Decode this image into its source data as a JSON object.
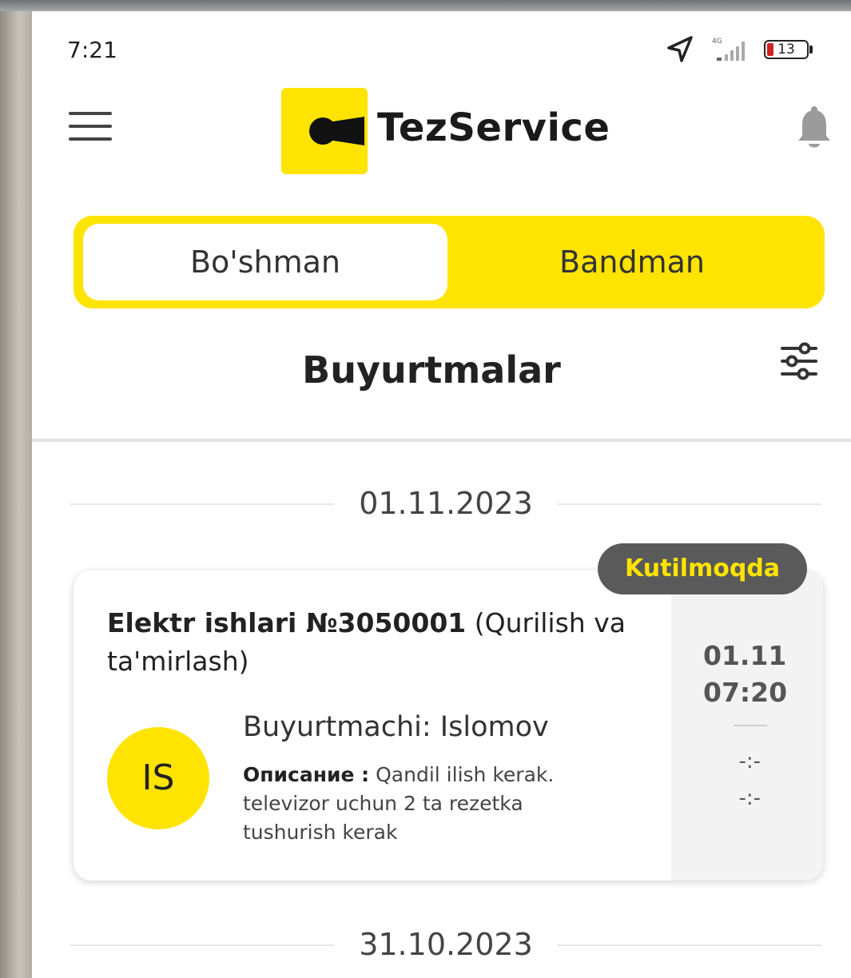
{
  "status_bar": {
    "time": "7:21",
    "network": "4G",
    "battery": "13"
  },
  "header": {
    "brand": "TezService",
    "menu_icon": "hamburger-menu-icon",
    "bell_icon": "bell-icon",
    "brand_color": "#fee400"
  },
  "toggle": {
    "options": [
      "Bo'shman",
      "Bandman"
    ],
    "selected": "Bo'shman"
  },
  "page": {
    "title": "Buyurtmalar",
    "filter_icon": "sliders-filter-icon"
  },
  "orders": {
    "groups": [
      {
        "date": "01.11.2023",
        "items": [
          {
            "status": "Kutilmoqda",
            "title_strong": "Elektr ishlari №3050001",
            "title_rest": " (Qurilish va ta'mirlash)",
            "avatar_initials": "IS",
            "customer": "Buyurtmachi: Islomov",
            "desc_label": "Описание :",
            "desc_text": " Qandil ilish kerak. televizor uchun 2 ta rezetka tushurish kerak",
            "date_short": "01.11",
            "time_short": "07:20",
            "time_placeholder_1": "-:-",
            "time_placeholder_2": "-:-"
          }
        ]
      },
      {
        "date": "31.10.2023",
        "items": []
      }
    ]
  }
}
